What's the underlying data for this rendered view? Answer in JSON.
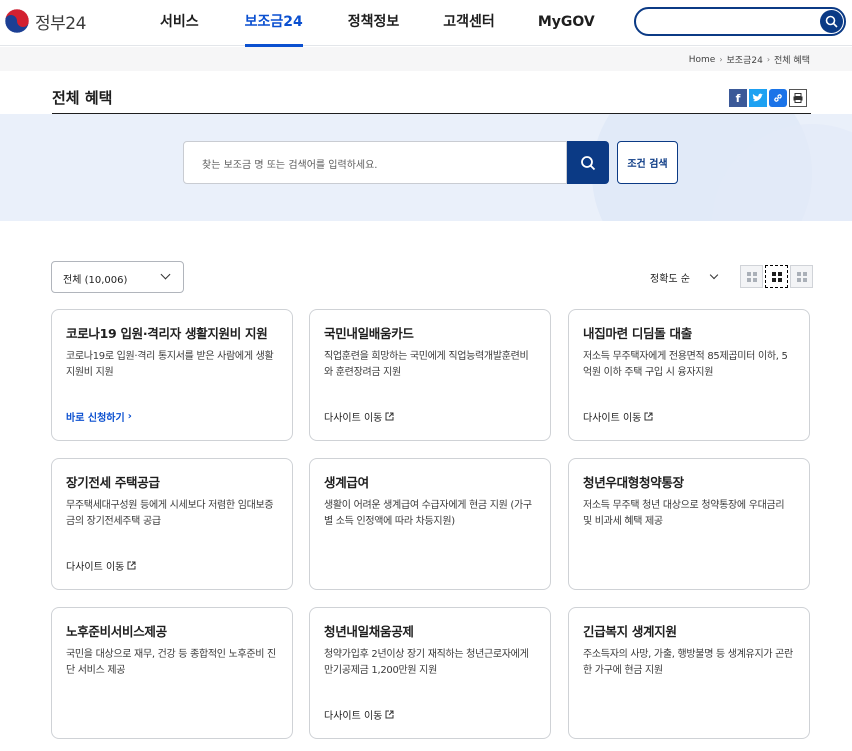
{
  "header": {
    "logo_text": "정부24",
    "nav": [
      "서비스",
      "보조금24",
      "정책정보",
      "고객센터",
      "MyGOV"
    ],
    "active_nav": "보조금24"
  },
  "breadcrumb": [
    "Home",
    "보조금24",
    "전체 혜택"
  ],
  "page_title": "전체 혜택",
  "search": {
    "placeholder": "찾는 보조금 명 또는 검색어를 입력하세요.",
    "condition_button": "조건 검색"
  },
  "filter": {
    "selected": "전체 (10,006)"
  },
  "sort": {
    "selected": "정확도 순"
  },
  "cards": [
    {
      "title": "코로나19 입원·격리자 생활지원비 지원",
      "desc": "코로나19로 입원·격리 통지서를 받은 사람에게 생활지원비 지원",
      "link": "바로 신청하기",
      "link_type": "apply"
    },
    {
      "title": "국민내일배움카드",
      "desc": "직업훈련을 희망하는 국민에게 직업능력개발훈련비와 훈련장려금 지원",
      "link": "다사이트 이동",
      "link_type": "external"
    },
    {
      "title": "내집마련 디딤돌 대출",
      "desc": "저소득 무주택자에게 전용면적 85제곱미터 이하, 5억원 이하 주택 구입 시 융자지원",
      "link": "다사이트 이동",
      "link_type": "external"
    },
    {
      "title": "장기전세 주택공급",
      "desc": "무주택세대구성원 등에게 시세보다 저렴한 임대보증금의 장기전세주택 공급",
      "link": "다사이트 이동",
      "link_type": "external"
    },
    {
      "title": "생계급여",
      "desc": "생활이 어려운 생계급여 수급자에게 현금 지원 (가구별 소득 인정액에 따라 차등지원)",
      "link": "",
      "link_type": "none"
    },
    {
      "title": "청년우대형청약통장",
      "desc": "저소득 무주택 청년 대상으로 청약통장에 우대금리 및 비과세 혜택 제공",
      "link": "",
      "link_type": "none"
    },
    {
      "title": "노후준비서비스제공",
      "desc": "국민을 대상으로 재무, 건강 등 종합적인 노후준비 진단 서비스 제공",
      "link": "",
      "link_type": "none"
    },
    {
      "title": "청년내일채움공제",
      "desc": "청약가입후 2년이상 장기 재직하는 청년근로자에게 만기공제금 1,200만원 지원",
      "link": "다사이트 이동",
      "link_type": "external"
    },
    {
      "title": "긴급복지 생계지원",
      "desc": "주소득자의 사망, 가출, 행방불명 등 생계유지가 곤란한 가구에 현금 지원",
      "link": "",
      "link_type": "none"
    }
  ]
}
